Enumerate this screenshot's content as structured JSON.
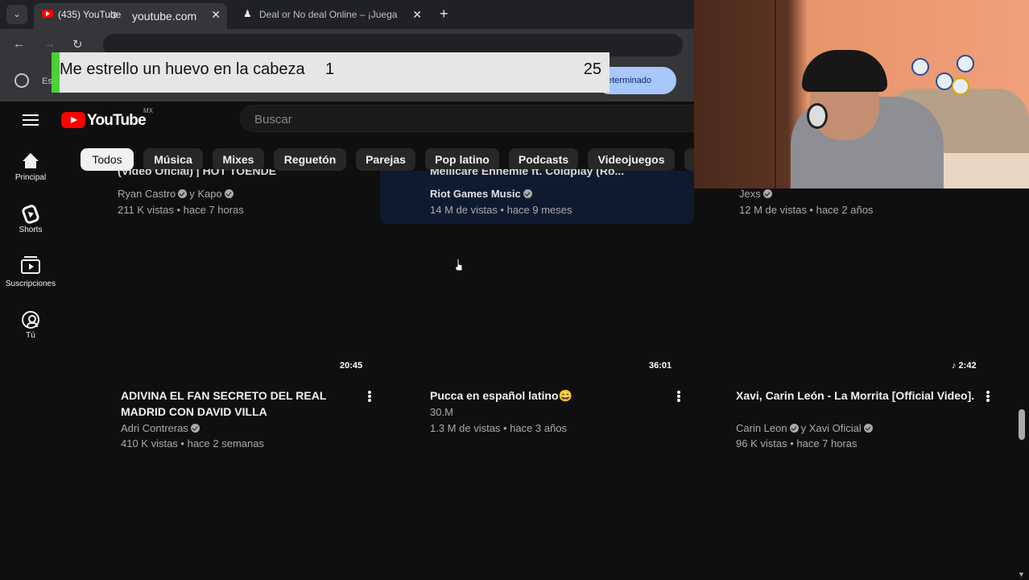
{
  "browser": {
    "tabs": [
      {
        "title": "(435) YouTube",
        "close": "✕"
      },
      {
        "title": "Deal or No deal Online – ¡Juega",
        "close": "✕"
      }
    ],
    "new_tab": "+",
    "tab_menu": "⌄",
    "url": "youtube.com",
    "bookmark_text": "Es",
    "pill_button": "eterminado"
  },
  "overlay": {
    "text": "Me estrello un huevo en la cabeza",
    "value_left": "1",
    "value_right": "25"
  },
  "youtube": {
    "logo_text": "YouTube",
    "country_code": "MX",
    "search_placeholder": "Buscar",
    "chips": [
      "Todos",
      "Música",
      "Mixes",
      "Reguetón",
      "Parejas",
      "Pop latino",
      "Podcasts",
      "Videojuegos"
    ],
    "sidebar": [
      {
        "label": "Principal"
      },
      {
        "label": "Shorts"
      },
      {
        "label": "Suscripciones"
      },
      {
        "label": "Tú"
      }
    ],
    "top_row": [
      {
        "title_partial": "(Video Oficial) | HOT TOENDE",
        "channel": "Ryan Castro",
        "channel2": "y Kapo",
        "meta": "211 K vistas • hace 7 horas"
      },
      {
        "title_partial": "Mellicare Enhemie ft. Coldplay (Ro...",
        "channel": "Riot Games Music",
        "meta": "14 M de vistas • hace 9 meses"
      },
      {
        "channel": "Jexs",
        "meta": "12 M de vistas • hace 2 años"
      }
    ],
    "videos": [
      {
        "duration": "20:45",
        "title": "ADIVINA EL FAN SECRETO DEL REAL MADRID CON DAVID VILLA",
        "channel": "Adri Contreras",
        "meta": "410 K vistas • hace 2 semanas"
      },
      {
        "duration": "36:01",
        "title": "Pucca en español latino😄",
        "channel": "30.M",
        "meta": "1.3 M de vistas • hace 3 años"
      },
      {
        "duration": "♪ 2:42",
        "title": "Xavi, Carin León - La Morrita [Official Video].",
        "channel": "Carin Leon",
        "channel2": "y Xavi Oficial",
        "meta": "96 K vistas • hace 7 horas"
      }
    ]
  },
  "colors": {
    "background": "#0f0f0f",
    "brand_red": "#ff0000",
    "chip_bg": "#272727",
    "overlay_green": "#4cd137"
  }
}
